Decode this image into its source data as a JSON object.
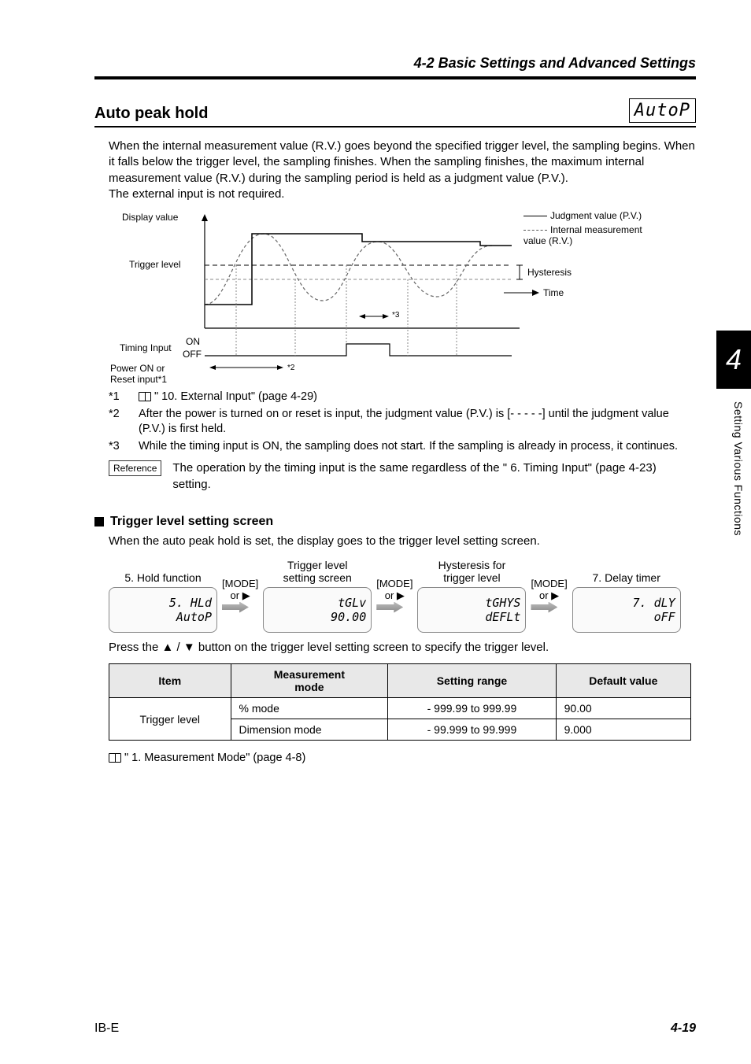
{
  "header": {
    "breadcrumb": "4-2  Basic Settings and Advanced Settings"
  },
  "side": {
    "chapter": "4",
    "label": "Setting Various Functions"
  },
  "section": {
    "title": "Auto peak hold",
    "seg_display": "AutoP",
    "intro": "When the internal measurement value (R.V.) goes beyond the specified trigger level, the sampling begins. When it falls below the trigger level, the sampling finishes. When the sampling finishes, the maximum internal measurement value (R.V.) during the sampling period is held as a judgment value (P.V.).\nThe external input is not required."
  },
  "chart": {
    "labels": {
      "display_value": "Display value",
      "trigger_level": "Trigger level",
      "timing_input": "Timing Input",
      "on": "ON",
      "off": "OFF",
      "power_on": "Power ON or\nReset input*1",
      "pv": "Judgment value (P.V.)",
      "rv": "Internal measurement\nvalue (R.V.)",
      "hysteresis": "Hysteresis",
      "time": "Time",
      "n2": "*2",
      "n3": "*3"
    }
  },
  "notes": {
    "n1_a": "*1",
    "n1_b": "\" 10. External Input\" (page 4-29)",
    "n2_a": "*2",
    "n2_b": "After the power is turned on or reset is input, the judgment value (P.V.) is [- - - - -] until the judgment value (P.V.) is first held.",
    "n3_a": "*3",
    "n3_b": "While the timing input is ON, the sampling does not start. If the sampling is already in process, it continues.",
    "ref_label": "Reference",
    "ref_text": "The operation by the timing input is the same regardless of the \" 6. Timing Input\" (page 4-23) setting."
  },
  "trigger_screen": {
    "heading": "Trigger level setting screen",
    "intro": "When the auto peak hold is set, the display goes to the trigger level setting screen.",
    "steps": {
      "s1_title": "5. Hold function",
      "s1_l1": "5. HLd",
      "s1_l2": "AutoP",
      "s2_title": "Trigger level\nsetting screen",
      "s2_l1": "tGLv",
      "s2_l2": "90.00",
      "s3_title": "Hysteresis for\ntrigger level",
      "s3_l1": "tGHYS",
      "s3_l2": "dEFLt",
      "s4_title": "7. Delay timer",
      "s4_l1": "7. dLY",
      "s4_l2": "oFF",
      "mode": "[MODE]",
      "or": "or ▶"
    },
    "press": "Press the ▲ / ▼ button on the trigger level setting screen to specify the trigger level."
  },
  "table": {
    "h_item": "Item",
    "h_mode": "Measurement\nmode",
    "h_range": "Setting range",
    "h_default": "Default value",
    "r_item": "Trigger level",
    "r1_mode": "% mode",
    "r1_range": "- 999.99 to 999.99",
    "r1_def": "90.00",
    "r2_mode": "Dimension mode",
    "r2_range": "- 99.999 to 99.999",
    "r2_def": "9.000"
  },
  "xref": "\" 1. Measurement Mode\" (page 4-8)",
  "footer": {
    "model": "IB-E",
    "page": "4-19"
  }
}
